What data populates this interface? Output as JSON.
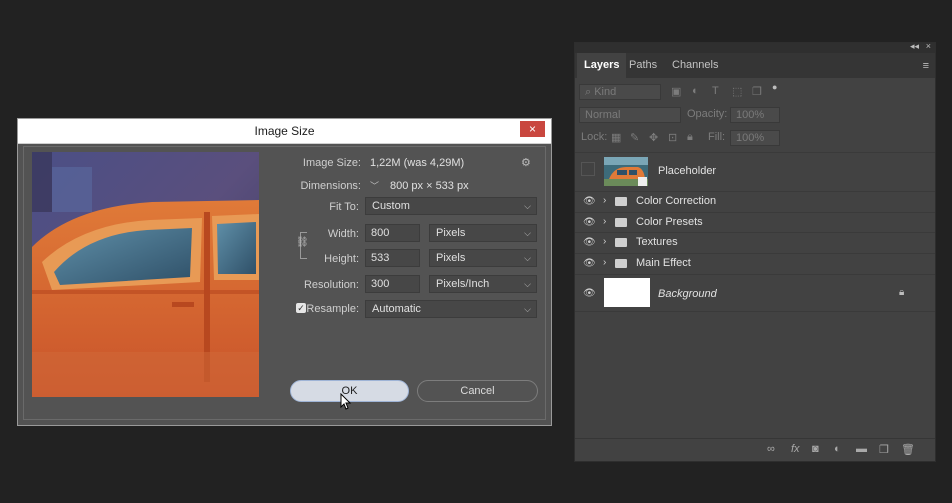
{
  "dialog": {
    "title": "Image Size",
    "close_icon": "×",
    "image_size_label": "Image Size:",
    "image_size_value": "1,22M (was 4,29M)",
    "dimensions_label": "Dimensions:",
    "dimensions_value": "800 px  ×  533 px",
    "fit_to_label": "Fit To:",
    "fit_to_value": "Custom",
    "width_label": "Width:",
    "width_value": "800",
    "width_unit": "Pixels",
    "height_label": "Height:",
    "height_value": "533",
    "height_unit": "Pixels",
    "resolution_label": "Resolution:",
    "resolution_value": "300",
    "resolution_unit": "Pixels/Inch",
    "resample_label": "Resample:",
    "resample_value": "Automatic",
    "ok_label": "OK",
    "cancel_label": "Cancel"
  },
  "layers_panel": {
    "tabs": [
      {
        "label": "Layers",
        "active": true
      },
      {
        "label": "Paths",
        "active": false
      },
      {
        "label": "Channels",
        "active": false
      }
    ],
    "filter_kind": "Kind",
    "blend_mode": "Normal",
    "opacity_label": "Opacity:",
    "opacity_value": "100%",
    "lock_label": "Lock:",
    "fill_label": "Fill:",
    "fill_value": "100%",
    "layers": [
      {
        "name": "Placeholder",
        "type": "smart-object"
      },
      {
        "name": "Color Correction",
        "type": "group"
      },
      {
        "name": "Color Presets",
        "type": "group"
      },
      {
        "name": "Textures",
        "type": "group"
      },
      {
        "name": "Main Effect",
        "type": "group"
      },
      {
        "name": "Background",
        "type": "background",
        "locked": true
      }
    ]
  },
  "colors": {
    "app_background": "#222222",
    "panel_background": "#424242",
    "dialog_background": "#535353",
    "close_button": "#c9473f",
    "car_orange": "#d8652e"
  }
}
